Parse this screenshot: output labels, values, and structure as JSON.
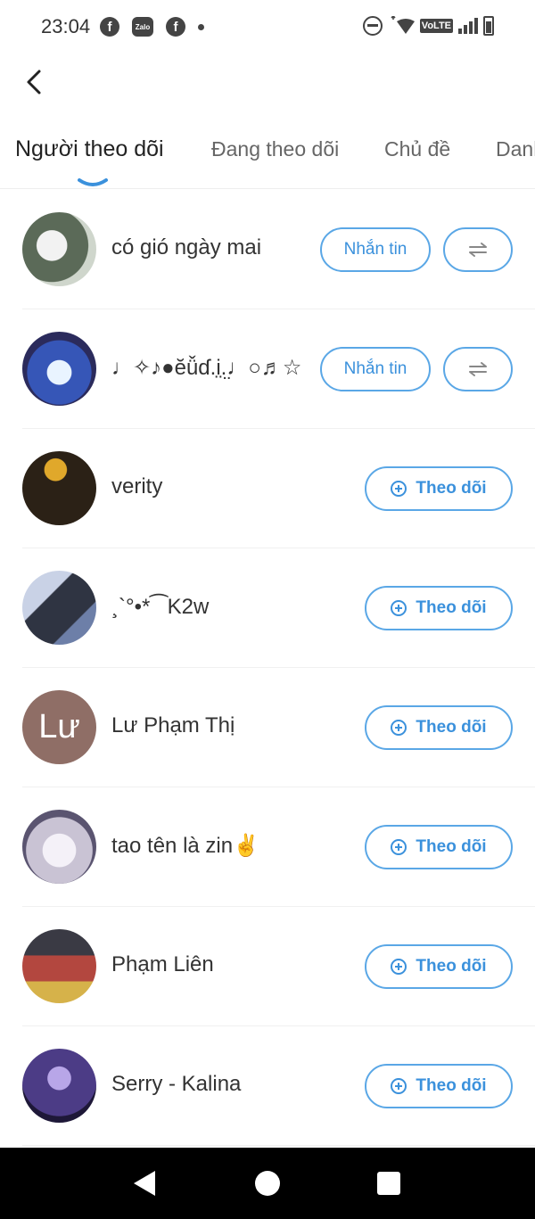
{
  "status_bar": {
    "time": "23:04",
    "left_icons": [
      "facebook-icon",
      "zalo-icon",
      "facebook-icon",
      "notification-dot"
    ],
    "right_icons": [
      "do-not-disturb-icon",
      "wifi-icon",
      "volte-icon",
      "signal-icon",
      "battery-icon"
    ],
    "zalo_label": "Zalo",
    "volte_label": "VoLTE"
  },
  "tabs": [
    {
      "label": "Người theo dõi",
      "active": true
    },
    {
      "label": "Đang theo dõi",
      "active": false
    },
    {
      "label": "Chủ đề",
      "active": false
    },
    {
      "label": "Danh",
      "active": false
    }
  ],
  "accent_color": "#3b91dc",
  "users": [
    {
      "name": "có gió ngày mai",
      "action": "message",
      "avatar_color": "#cfd6cc"
    },
    {
      "name": "♩✧♪●ĕǚɗ.i̤.̤♩○♬☆",
      "action": "message",
      "avatar_color": "#3656b7"
    },
    {
      "name": "verity",
      "action": "follow",
      "avatar_color": "#2b2116"
    },
    {
      "name": "¸`°•*⁀K2w",
      "action": "follow",
      "avatar_color": "#4a5062"
    },
    {
      "name": "Lư Phạm Thị",
      "action": "follow",
      "avatar_color": "#8f6e66",
      "avatar_letters": "Lư"
    },
    {
      "name": "tao tên là zin✌️",
      "action": "follow",
      "avatar_color": "#c9c3d4"
    },
    {
      "name": "Phạm Liên",
      "action": "follow",
      "avatar_color": "#6e5a45"
    },
    {
      "name": "Serry - Kalina",
      "action": "follow",
      "avatar_color": "#4c3c86"
    }
  ],
  "buttons": {
    "message_label": "Nhắn tin",
    "follow_label": "Theo dõi"
  }
}
